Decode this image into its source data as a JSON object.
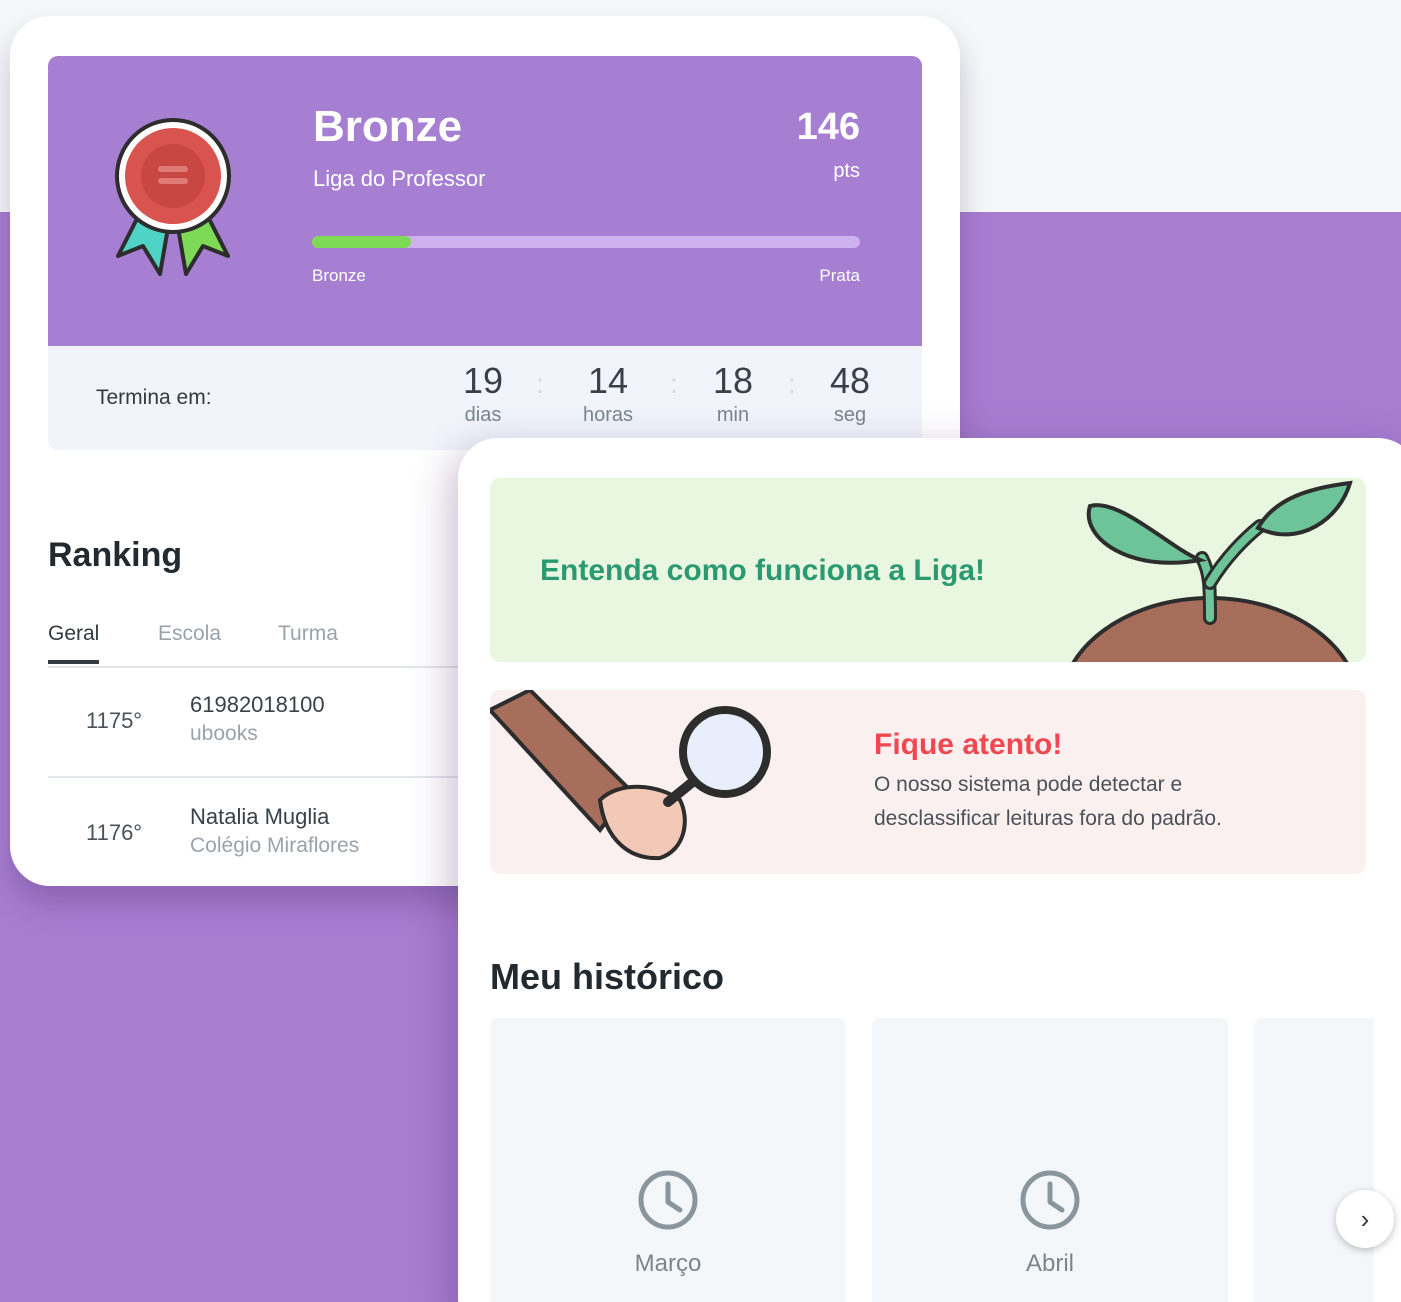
{
  "league": {
    "name": "Bronze",
    "subtitle": "Liga do Professor",
    "points": "146",
    "points_label": "pts",
    "progress_fraction": 0.18,
    "progress_start": "Bronze",
    "progress_end": "Prata"
  },
  "countdown": {
    "label": "Termina em:",
    "units": [
      {
        "value": "19",
        "label": "dias"
      },
      {
        "value": "14",
        "label": "horas"
      },
      {
        "value": "18",
        "label": "min"
      },
      {
        "value": "48",
        "label": "seg"
      }
    ],
    "separator": ":"
  },
  "ranking": {
    "title": "Ranking",
    "tabs": [
      "Geral",
      "Escola",
      "Turma"
    ],
    "active_tab": "Geral",
    "rows": [
      {
        "position": "1175°",
        "name": "61982018100",
        "school": "ubooks"
      },
      {
        "position": "1176°",
        "name": "Natalia Muglia",
        "school": "Colégio Miraflores"
      }
    ]
  },
  "info_banner": {
    "text": "Entenda como funciona a Liga!"
  },
  "alert": {
    "title": "Fique atento!",
    "text": "O nosso sistema pode detectar e desclassificar leituras fora do padrão."
  },
  "history": {
    "title": "Meu histórico",
    "months": [
      "Março",
      "Abril"
    ],
    "icon": "clock-icon",
    "next_icon": "chevron-right-icon"
  },
  "colors": {
    "purple": "#a67fd2",
    "progress": "#7ed957",
    "green_text": "#2b9a72",
    "red_text": "#f04850"
  }
}
